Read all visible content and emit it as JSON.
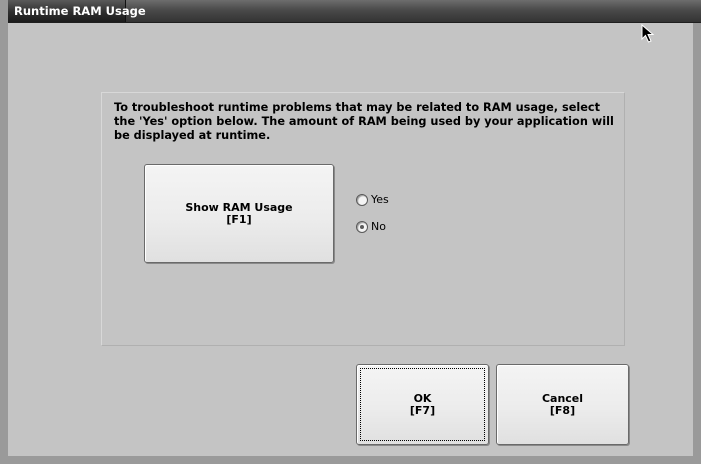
{
  "window": {
    "title": "Runtime RAM Usage"
  },
  "panel": {
    "instructions": "To troubleshoot runtime problems that may be related to RAM usage, select the 'Yes' option below. The amount of RAM being used by your application will be displayed at runtime."
  },
  "ram_button": {
    "label": "Show RAM Usage",
    "key": "[F1]"
  },
  "options": {
    "yes_label": "Yes",
    "no_label": "No",
    "selected": "No"
  },
  "footer": {
    "ok_label": "OK",
    "ok_key": "[F7]",
    "cancel_label": "Cancel",
    "cancel_key": "[F8]"
  }
}
